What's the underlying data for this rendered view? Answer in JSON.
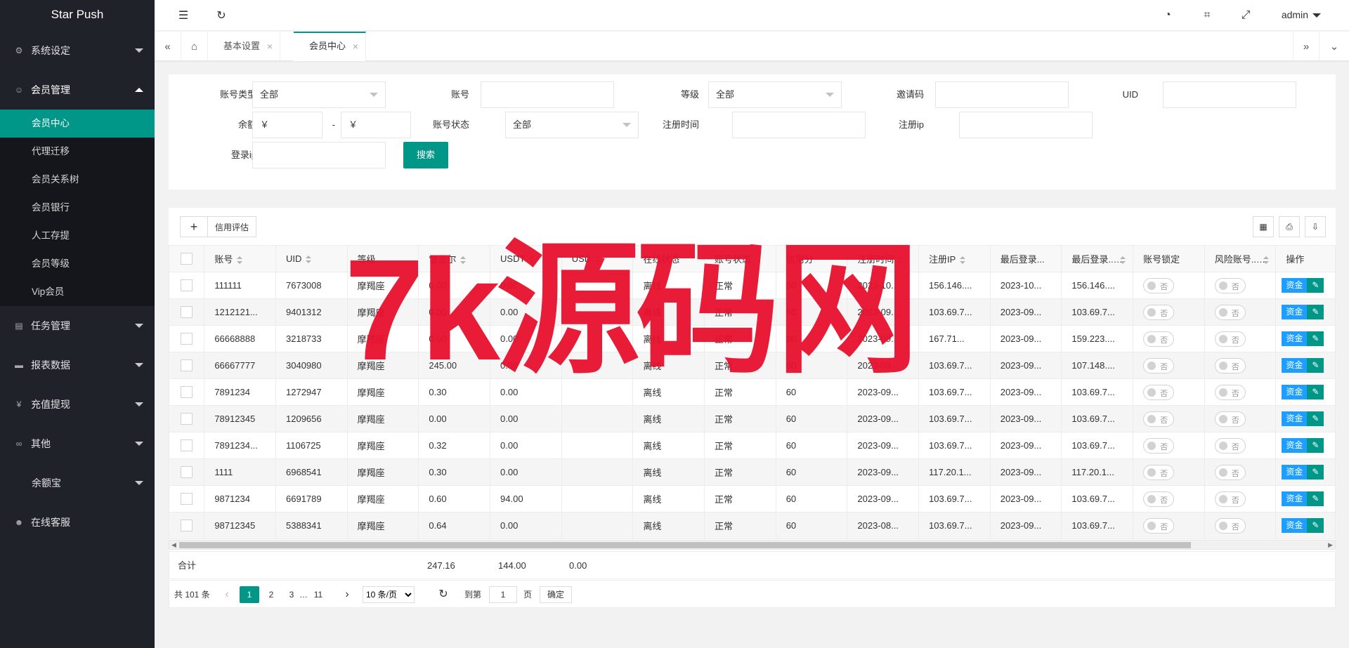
{
  "app": {
    "title": "Star Push"
  },
  "sidebar": {
    "groups": [
      {
        "label": "系统设定",
        "icon": "gear-icon"
      },
      {
        "label": "会员管理",
        "icon": "user-icon"
      },
      {
        "label": "任务管理",
        "icon": "task-icon"
      },
      {
        "label": "报表数据",
        "icon": "report-icon"
      },
      {
        "label": "充值提现",
        "icon": "money-icon"
      },
      {
        "label": "其他",
        "icon": "link-icon"
      },
      {
        "label": "余额宝",
        "icon": ""
      },
      {
        "label": "在线客服",
        "icon": "support-icon"
      }
    ],
    "sub_items": [
      "会员中心",
      "代理迁移",
      "会员关系树",
      "会员银行",
      "人工存提",
      "会员等级",
      "Vip会员"
    ]
  },
  "header": {
    "user": "admin"
  },
  "tabs": [
    {
      "label": "基本设置",
      "close": "×"
    },
    {
      "label": "会员中心",
      "close": "×"
    }
  ],
  "filters": {
    "account_type_label": "账号类型",
    "account_type_value": "全部",
    "account_label": "账号",
    "level_label": "等级",
    "level_value": "全部",
    "invite_label": "邀请码",
    "uid_label": "UID",
    "balance_label": "余额",
    "balance_min": "￥",
    "balance_dash": "-",
    "balance_max": "￥",
    "status_label": "账号状态",
    "status_value": "全部",
    "reg_time_label": "注册时间",
    "reg_ip_label": "注册ip",
    "login_ip_label": "登录ip",
    "search_button": "搜索"
  },
  "toolbar": {
    "add": "+",
    "credit": "信用评估"
  },
  "table": {
    "columns": [
      "账号",
      "UID",
      "等级",
      "雷亚尔",
      "USDT",
      "USD",
      "在线状态",
      "账号状态",
      "信用分",
      "注册时间",
      "注册IP",
      "最后登录...",
      "最后登录...",
      "账号锁定",
      "风险账号...",
      "操作"
    ],
    "switch_off": "否",
    "fund_button": "资金",
    "edit_button": "✎",
    "rows": [
      [
        "111111",
        "7673008",
        "摩羯座",
        "0.00",
        "0.00",
        "",
        "离线",
        "正常",
        "60",
        "2023-10...",
        "156.146....",
        "2023-10...",
        "156.146...."
      ],
      [
        "1212121...",
        "9401312",
        "摩羯座",
        "0.00",
        "0.00",
        "",
        "离线",
        "正常",
        "60",
        "2023-09...",
        "103.69.7...",
        "2023-09...",
        "103.69.7..."
      ],
      [
        "66668888",
        "3218733",
        "摩羯座",
        "0.00",
        "0.00",
        "",
        "离线",
        "正常",
        "60",
        "2023-09...",
        "167.71...",
        "2023-09...",
        "159.223...."
      ],
      [
        "66667777",
        "3040980",
        "摩羯座",
        "245.00",
        "0.00",
        "",
        "离线",
        "正常",
        "60",
        "2023-09...",
        "103.69.7...",
        "2023-09...",
        "107.148...."
      ],
      [
        "7891234",
        "1272947",
        "摩羯座",
        "0.30",
        "0.00",
        "",
        "离线",
        "正常",
        "60",
        "2023-09...",
        "103.69.7...",
        "2023-09...",
        "103.69.7..."
      ],
      [
        "78912345",
        "1209656",
        "摩羯座",
        "0.00",
        "0.00",
        "",
        "离线",
        "正常",
        "60",
        "2023-09...",
        "103.69.7...",
        "2023-09...",
        "103.69.7..."
      ],
      [
        "7891234...",
        "1106725",
        "摩羯座",
        "0.32",
        "0.00",
        "",
        "离线",
        "正常",
        "60",
        "2023-09...",
        "103.69.7...",
        "2023-09...",
        "103.69.7..."
      ],
      [
        "1111",
        "6968541",
        "摩羯座",
        "0.30",
        "0.00",
        "",
        "离线",
        "正常",
        "60",
        "2023-09...",
        "117.20.1...",
        "2023-09...",
        "117.20.1..."
      ],
      [
        "9871234",
        "6691789",
        "摩羯座",
        "0.60",
        "94.00",
        "",
        "离线",
        "正常",
        "60",
        "2023-09...",
        "103.69.7...",
        "2023-09...",
        "103.69.7..."
      ],
      [
        "98712345",
        "5388341",
        "摩羯座",
        "0.64",
        "0.00",
        "",
        "离线",
        "正常",
        "60",
        "2023-08...",
        "103.69.7...",
        "2023-09...",
        "103.69.7..."
      ]
    ],
    "totals": {
      "label": "合计",
      "real": "247.16",
      "usdt": "144.00",
      "usd": "0.00"
    }
  },
  "pagination": {
    "total": "共 101 条",
    "prev": "‹",
    "pages": [
      "1",
      "2",
      "3"
    ],
    "ellipsis": "…",
    "last_page": "11",
    "next": "›",
    "page_size": "10 条/页",
    "goto_label": "到第",
    "goto_value": "1",
    "page_unit": "页",
    "confirm": "确定"
  },
  "watermark": "7k源码网"
}
